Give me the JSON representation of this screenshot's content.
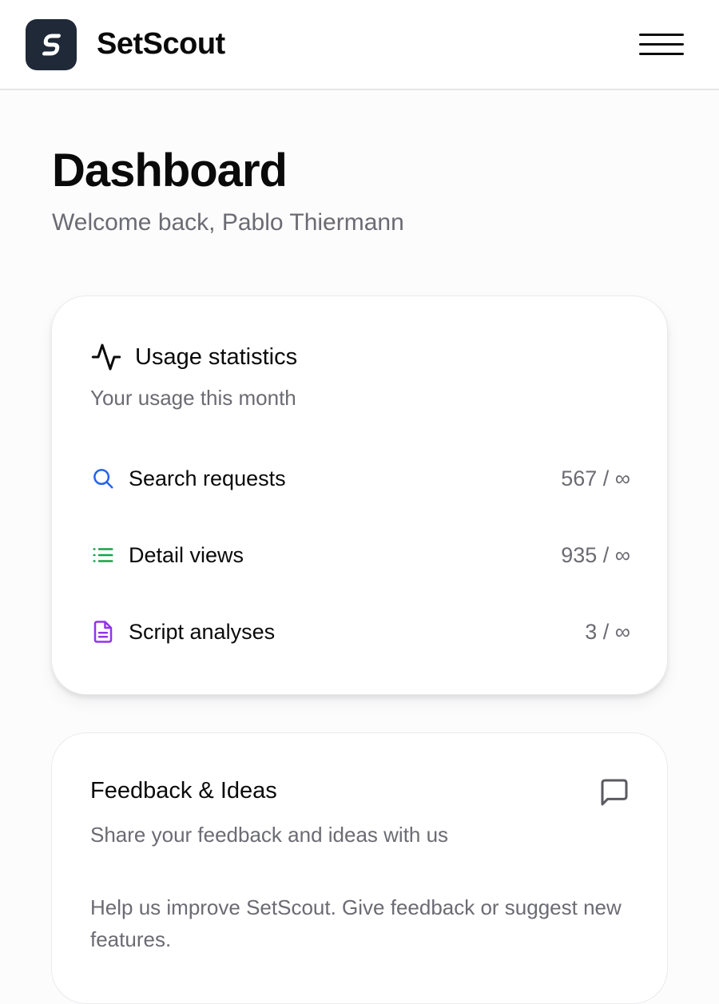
{
  "app": {
    "name": "SetScout"
  },
  "page": {
    "title": "Dashboard",
    "welcome": "Welcome back, Pablo Thiermann"
  },
  "usage": {
    "title": "Usage statistics",
    "description": "Your usage this month",
    "title_icon": "activity-icon",
    "items": [
      {
        "label": "Search requests",
        "value": "567 / ∞",
        "icon": "search-icon",
        "color": "#2563eb"
      },
      {
        "label": "Detail views",
        "value": "935 / ∞",
        "icon": "list-icon",
        "color": "#16a34a"
      },
      {
        "label": "Script analyses",
        "value": "3 / ∞",
        "icon": "file-text-icon",
        "color": "#9333ea"
      }
    ]
  },
  "feedback": {
    "title": "Feedback & Ideas",
    "description": "Share your feedback and ideas with us",
    "body": "Help us improve SetScout. Give feedback or suggest new features.",
    "icon": "message-square-icon"
  },
  "colors": {
    "logo_bg": "#1f2937",
    "muted_text": "#6b6b73"
  }
}
